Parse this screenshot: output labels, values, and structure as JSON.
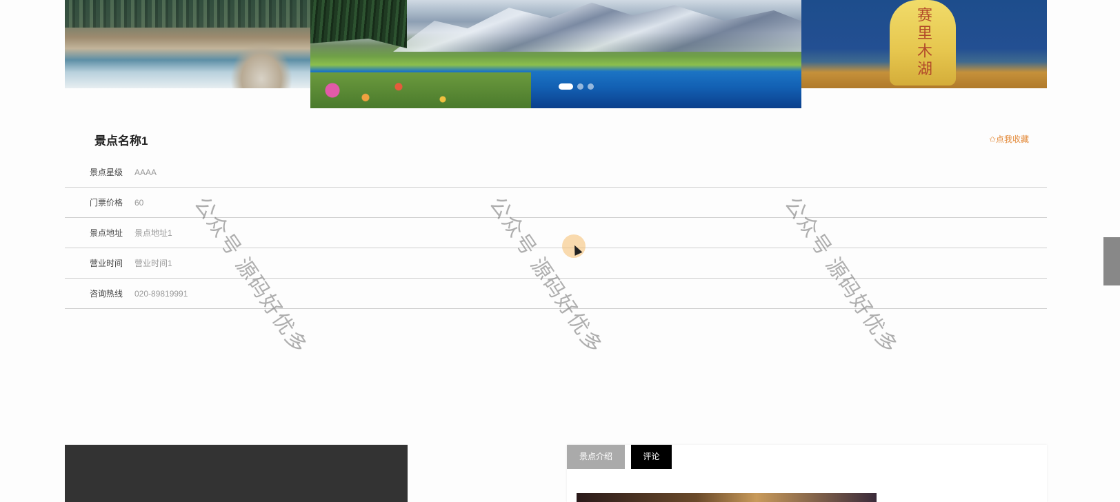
{
  "carousel": {
    "left_stone_text": "赛里木湖",
    "indicator_count": 3,
    "active_index": 0
  },
  "spot": {
    "title": "景点名称1",
    "favorite_label": "✩点我收藏"
  },
  "info": [
    {
      "label": "景点星级",
      "value": "AAAA"
    },
    {
      "label": "门票价格",
      "value": "60"
    },
    {
      "label": "景点地址",
      "value": "景点地址1"
    },
    {
      "label": "营业时间",
      "value": "营业时间1"
    },
    {
      "label": "咨询热线",
      "value": "020-89819991"
    }
  ],
  "tabs": [
    {
      "label": "景点介绍"
    },
    {
      "label": "评论"
    }
  ],
  "watermark": "公众号 源码好优多",
  "colors": {
    "accent": "#e38a3a",
    "row_border": "#cfcfcf",
    "tab_inactive": "#aaaaaa",
    "tab_active": "#000000"
  }
}
